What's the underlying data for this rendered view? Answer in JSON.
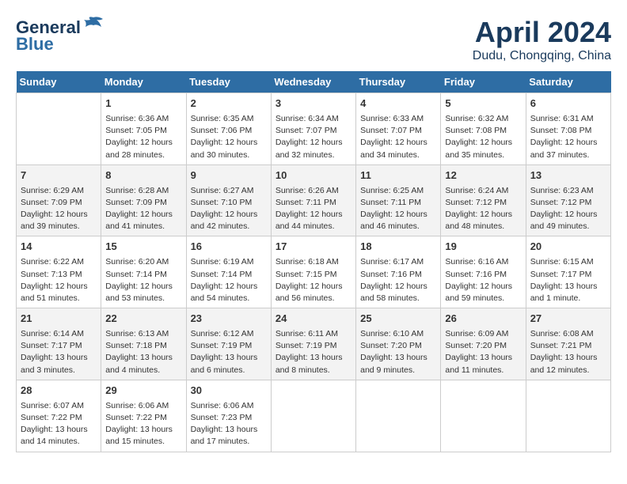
{
  "header": {
    "logo_line1": "General",
    "logo_line2": "Blue",
    "month": "April 2024",
    "location": "Dudu, Chongqing, China"
  },
  "weekdays": [
    "Sunday",
    "Monday",
    "Tuesday",
    "Wednesday",
    "Thursday",
    "Friday",
    "Saturday"
  ],
  "weeks": [
    [
      {
        "day": "",
        "info": ""
      },
      {
        "day": "1",
        "info": "Sunrise: 6:36 AM\nSunset: 7:05 PM\nDaylight: 12 hours\nand 28 minutes."
      },
      {
        "day": "2",
        "info": "Sunrise: 6:35 AM\nSunset: 7:06 PM\nDaylight: 12 hours\nand 30 minutes."
      },
      {
        "day": "3",
        "info": "Sunrise: 6:34 AM\nSunset: 7:07 PM\nDaylight: 12 hours\nand 32 minutes."
      },
      {
        "day": "4",
        "info": "Sunrise: 6:33 AM\nSunset: 7:07 PM\nDaylight: 12 hours\nand 34 minutes."
      },
      {
        "day": "5",
        "info": "Sunrise: 6:32 AM\nSunset: 7:08 PM\nDaylight: 12 hours\nand 35 minutes."
      },
      {
        "day": "6",
        "info": "Sunrise: 6:31 AM\nSunset: 7:08 PM\nDaylight: 12 hours\nand 37 minutes."
      }
    ],
    [
      {
        "day": "7",
        "info": "Sunrise: 6:29 AM\nSunset: 7:09 PM\nDaylight: 12 hours\nand 39 minutes."
      },
      {
        "day": "8",
        "info": "Sunrise: 6:28 AM\nSunset: 7:09 PM\nDaylight: 12 hours\nand 41 minutes."
      },
      {
        "day": "9",
        "info": "Sunrise: 6:27 AM\nSunset: 7:10 PM\nDaylight: 12 hours\nand 42 minutes."
      },
      {
        "day": "10",
        "info": "Sunrise: 6:26 AM\nSunset: 7:11 PM\nDaylight: 12 hours\nand 44 minutes."
      },
      {
        "day": "11",
        "info": "Sunrise: 6:25 AM\nSunset: 7:11 PM\nDaylight: 12 hours\nand 46 minutes."
      },
      {
        "day": "12",
        "info": "Sunrise: 6:24 AM\nSunset: 7:12 PM\nDaylight: 12 hours\nand 48 minutes."
      },
      {
        "day": "13",
        "info": "Sunrise: 6:23 AM\nSunset: 7:12 PM\nDaylight: 12 hours\nand 49 minutes."
      }
    ],
    [
      {
        "day": "14",
        "info": "Sunrise: 6:22 AM\nSunset: 7:13 PM\nDaylight: 12 hours\nand 51 minutes."
      },
      {
        "day": "15",
        "info": "Sunrise: 6:20 AM\nSunset: 7:14 PM\nDaylight: 12 hours\nand 53 minutes."
      },
      {
        "day": "16",
        "info": "Sunrise: 6:19 AM\nSunset: 7:14 PM\nDaylight: 12 hours\nand 54 minutes."
      },
      {
        "day": "17",
        "info": "Sunrise: 6:18 AM\nSunset: 7:15 PM\nDaylight: 12 hours\nand 56 minutes."
      },
      {
        "day": "18",
        "info": "Sunrise: 6:17 AM\nSunset: 7:16 PM\nDaylight: 12 hours\nand 58 minutes."
      },
      {
        "day": "19",
        "info": "Sunrise: 6:16 AM\nSunset: 7:16 PM\nDaylight: 12 hours\nand 59 minutes."
      },
      {
        "day": "20",
        "info": "Sunrise: 6:15 AM\nSunset: 7:17 PM\nDaylight: 13 hours\nand 1 minute."
      }
    ],
    [
      {
        "day": "21",
        "info": "Sunrise: 6:14 AM\nSunset: 7:17 PM\nDaylight: 13 hours\nand 3 minutes."
      },
      {
        "day": "22",
        "info": "Sunrise: 6:13 AM\nSunset: 7:18 PM\nDaylight: 13 hours\nand 4 minutes."
      },
      {
        "day": "23",
        "info": "Sunrise: 6:12 AM\nSunset: 7:19 PM\nDaylight: 13 hours\nand 6 minutes."
      },
      {
        "day": "24",
        "info": "Sunrise: 6:11 AM\nSunset: 7:19 PM\nDaylight: 13 hours\nand 8 minutes."
      },
      {
        "day": "25",
        "info": "Sunrise: 6:10 AM\nSunset: 7:20 PM\nDaylight: 13 hours\nand 9 minutes."
      },
      {
        "day": "26",
        "info": "Sunrise: 6:09 AM\nSunset: 7:20 PM\nDaylight: 13 hours\nand 11 minutes."
      },
      {
        "day": "27",
        "info": "Sunrise: 6:08 AM\nSunset: 7:21 PM\nDaylight: 13 hours\nand 12 minutes."
      }
    ],
    [
      {
        "day": "28",
        "info": "Sunrise: 6:07 AM\nSunset: 7:22 PM\nDaylight: 13 hours\nand 14 minutes."
      },
      {
        "day": "29",
        "info": "Sunrise: 6:06 AM\nSunset: 7:22 PM\nDaylight: 13 hours\nand 15 minutes."
      },
      {
        "day": "30",
        "info": "Sunrise: 6:06 AM\nSunset: 7:23 PM\nDaylight: 13 hours\nand 17 minutes."
      },
      {
        "day": "",
        "info": ""
      },
      {
        "day": "",
        "info": ""
      },
      {
        "day": "",
        "info": ""
      },
      {
        "day": "",
        "info": ""
      }
    ]
  ]
}
